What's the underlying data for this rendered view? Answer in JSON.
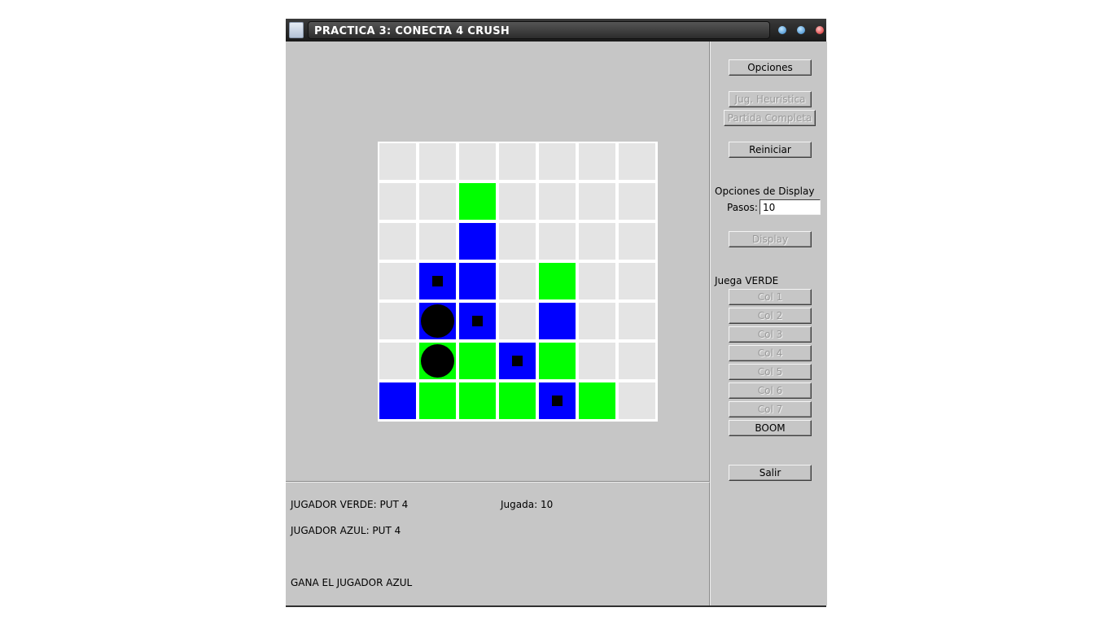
{
  "window": {
    "title": "PRACTICA 3: CONECTA 4 CRUSH",
    "icons": {
      "app": "app-icon",
      "minimize": "minimize-icon",
      "maximize": "maximize-icon",
      "close": "close-icon"
    }
  },
  "colors": {
    "green": "#00ff00",
    "blue": "#0000ff",
    "empty": "#e4e4e4",
    "marker": "#000000",
    "background": "#c6c6c6"
  },
  "board": {
    "legend": {
      "G": "green piece",
      "B": "blue piece",
      ".": "empty",
      "sq": "small black square marker",
      "dot": "black disc marker"
    },
    "rows": [
      [
        ".",
        ".",
        ".",
        ".",
        ".",
        ".",
        "."
      ],
      [
        ".",
        ".",
        "G",
        ".",
        ".",
        ".",
        "."
      ],
      [
        ".",
        ".",
        "B",
        ".",
        ".",
        ".",
        "."
      ],
      [
        ".",
        "B:sq",
        "B",
        ".",
        "G",
        ".",
        "."
      ],
      [
        ".",
        "B:dot",
        "B:sq",
        ".",
        "B",
        ".",
        "."
      ],
      [
        ".",
        "G:dot",
        "G",
        "B:sq",
        "G",
        ".",
        "."
      ],
      [
        "B",
        "G",
        "G",
        "G",
        "B:sq",
        "G",
        "."
      ]
    ]
  },
  "status": {
    "green_player": "JUGADOR VERDE: PUT 4",
    "blue_player": "JUGADOR AZUL: PUT 4",
    "move": "Jugada: 10",
    "result": "GANA EL JUGADOR AZUL"
  },
  "panel": {
    "options_button": "Opciones",
    "heuristic_button": "Jug. Heuristica",
    "full_game_button": "Partida Completa",
    "restart_button": "Reiniciar",
    "display_options_label": "Opciones de Display",
    "steps_label": "Pasos:",
    "steps_value": "10",
    "display_button": "Display",
    "turn_label": "Juega VERDE",
    "columns": [
      "Col 1",
      "Col 2",
      "Col 3",
      "Col 4",
      "Col 5",
      "Col 6",
      "Col 7"
    ],
    "boom_button": "BOOM",
    "exit_button": "Salir"
  }
}
